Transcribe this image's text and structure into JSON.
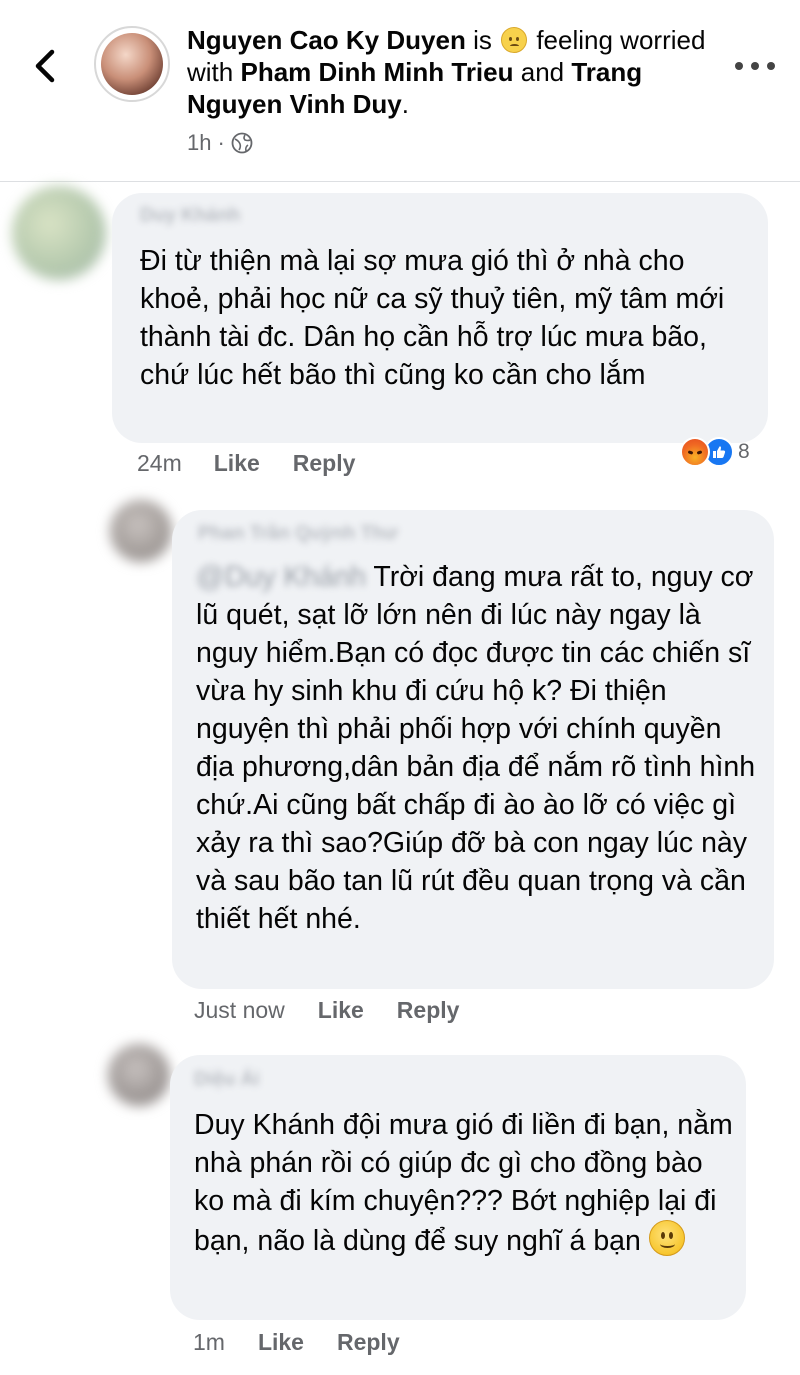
{
  "post": {
    "author": "Nguyen Cao Ky Duyen",
    "is_word": "is",
    "feeling_pre": "feeling",
    "feeling_post": "worried with",
    "tagged_1": "Pham Dinh Minh Trieu",
    "and_word": "and",
    "tagged_2": "Trang Nguyen Vinh Duy",
    "end_punct": ".",
    "time": "1h",
    "dot": "·",
    "feeling_icon": "worried-face-icon",
    "privacy_icon": "globe-icon"
  },
  "comments": [
    {
      "name": "Duy Khánh",
      "text": "Đi từ thiện mà lại sợ mưa gió thì ở nhà cho khoẻ, phải học nữ ca sỹ thuỷ tiên, mỹ tâm mới thành tài đc. Dân họ cần hỗ trợ lúc mưa bão, chứ lúc hết bão thì cũng ko cần cho lắm",
      "time": "24m",
      "like": "Like",
      "reply": "Reply",
      "reaction_count": "8",
      "reaction_icons": [
        "angry-reaction-icon",
        "like-reaction-icon"
      ]
    },
    {
      "name": "Phan Trần Quỳnh Thư",
      "tag": "@Duy Khánh",
      "text": "Trời đang mưa rất to, nguy cơ lũ quét, sạt lỡ lớn nên đi lúc này ngay là nguy hiểm.Bạn có đọc được tin các chiến sĩ vừa hy sinh khu đi cứu hộ k? Đi thiện nguyện thì phải phối hợp với chính quyền địa phương,dân bản địa để nắm rõ tình hình chứ.Ai cũng bất chấp đi ào ào lỡ có việc gì xảy ra thì sao?Giúp đỡ bà con ngay lúc này và sau bão tan lũ rút đều quan trọng và cần thiết hết nhé.",
      "time": "Just now",
      "like": "Like",
      "reply": "Reply"
    },
    {
      "name": "Diệu Ái",
      "text": "Duy Khánh đội mưa gió đi liền đi bạn, nằm nhà phán rồi có giúp đc gì cho đồng bào ko mà đi kím chuyện??? Bớt nghiệp lại đi bạn, não là dùng để suy nghĩ á bạn",
      "emoji": "smiling-face-icon",
      "time": "1m",
      "like": "Like",
      "reply": "Reply"
    }
  ],
  "colors": {
    "bubble": "#f0f2f5",
    "meta_text": "#65676b",
    "like_blue": "#1877f2",
    "divider": "#dddfe2"
  }
}
